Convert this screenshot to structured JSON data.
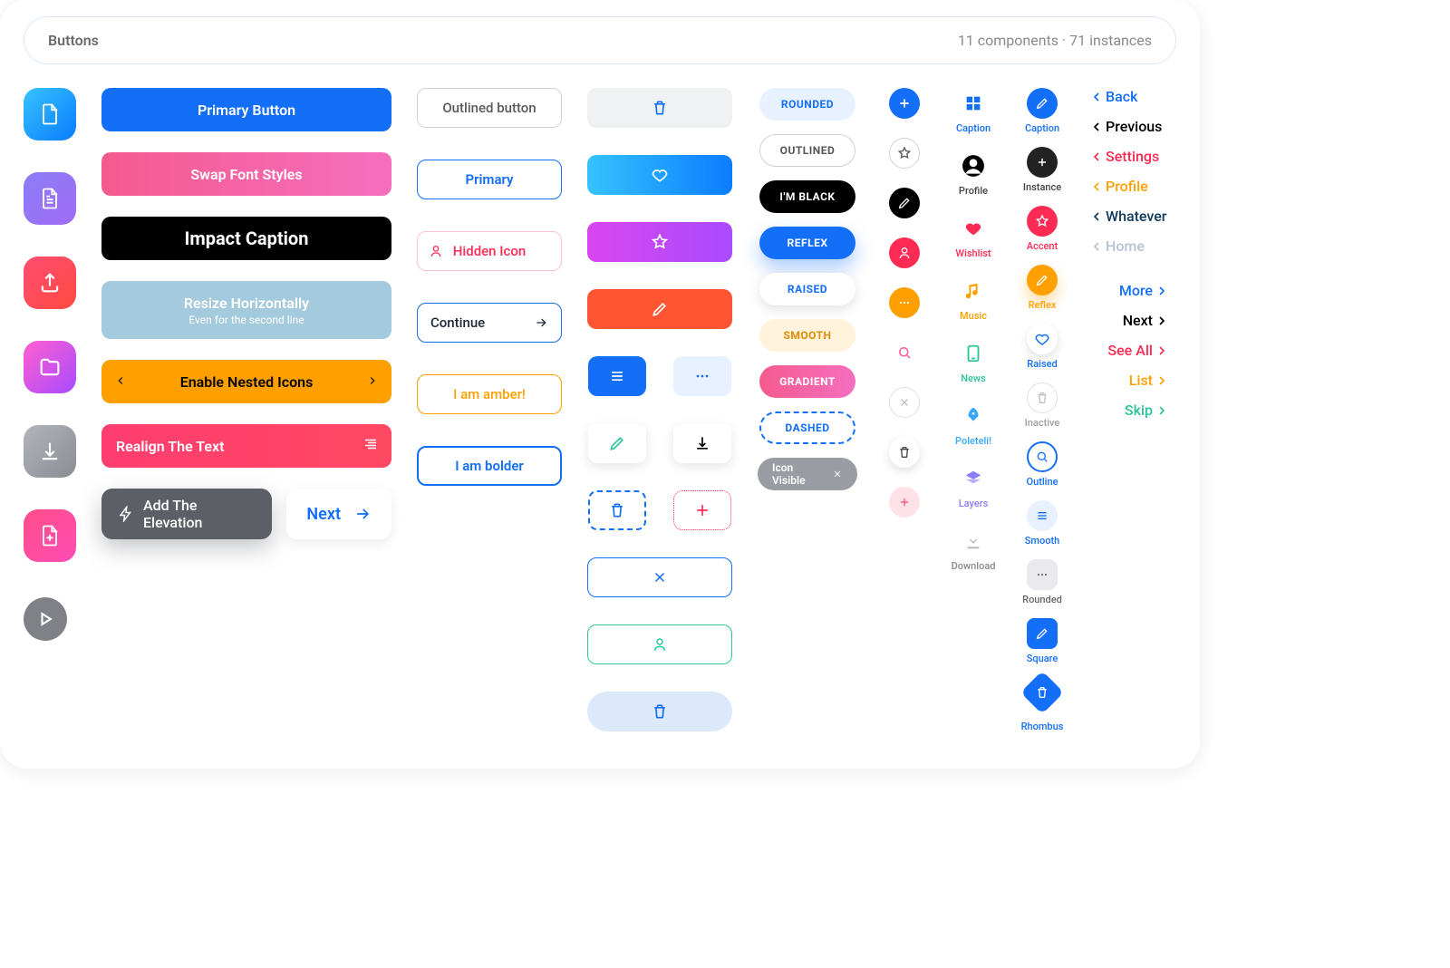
{
  "header": {
    "title": "Buttons",
    "sub": "11 components · 71 instances"
  },
  "wide": [
    {
      "label": "Primary Button"
    },
    {
      "label": "Swap Font Styles"
    },
    {
      "label": "Impact Caption"
    },
    {
      "label": "Resize Horizontally",
      "sub": "Even for the second line"
    },
    {
      "label": "Enable Nested Icons"
    },
    {
      "label": "Realign The Text"
    }
  ],
  "elev": {
    "label": "Add The Elevation",
    "next": "Next"
  },
  "outline": [
    {
      "label": "Outlined button"
    },
    {
      "label": "Primary"
    },
    {
      "label": "Hidden Icon"
    },
    {
      "label": "Continue"
    },
    {
      "label": "I am amber!"
    },
    {
      "label": "I am bolder"
    }
  ],
  "chips": [
    {
      "label": "ROUNDED"
    },
    {
      "label": "OUTLINED"
    },
    {
      "label": "I'M BLACK"
    },
    {
      "label": "REFLEX"
    },
    {
      "label": "RAISED"
    },
    {
      "label": "SMOOTH"
    },
    {
      "label": "GRADIENT"
    },
    {
      "label": "DASHED"
    },
    {
      "label": "Icon Visible"
    }
  ],
  "captionset7": [
    "Caption",
    "Profile",
    "Wishlist",
    "Music",
    "News",
    "Poleteli!",
    "Layers",
    "Download"
  ],
  "captionset8": [
    "Caption",
    "Instance",
    "Accent",
    "Reflex",
    "Raised",
    "Inactive",
    "Outline",
    "Smooth",
    "Rounded",
    "Square",
    "Rhombus"
  ],
  "backlinks": [
    "Back",
    "Previous",
    "Settings",
    "Profile",
    "Whatever",
    "Home"
  ],
  "nextlinks": [
    "More",
    "Next",
    "See All",
    "List",
    "Skip"
  ]
}
